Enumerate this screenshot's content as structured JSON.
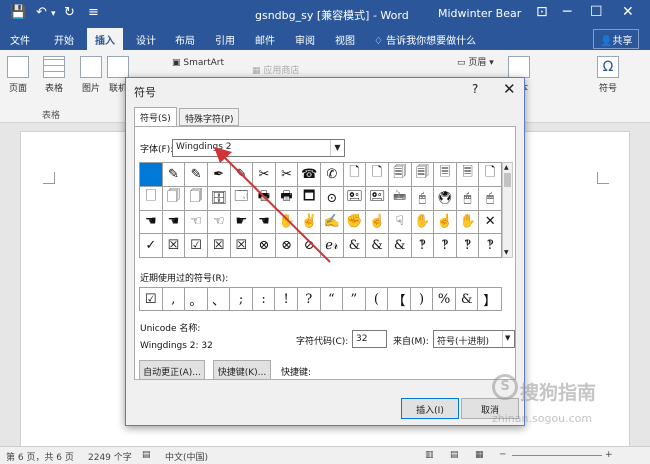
{
  "titlebar": {
    "save_icon": "💾",
    "undo_icon": "↶",
    "undo_dropdown": "▾",
    "redo_icon": "↻",
    "customize_icon": "≡",
    "doc_title": "gsndbg_sy [兼容模式] - Word",
    "user": "Midwinter Bear",
    "ribbon_toggle": "⊡",
    "minimize": "─",
    "maximize": "☐",
    "close": "✕"
  },
  "ribbon_tabs": [
    "文件",
    "开始",
    "插入",
    "设计",
    "布局",
    "引用",
    "邮件",
    "审阅",
    "视图"
  ],
  "tell_me": "告诉我你想要做什么",
  "share": "共享",
  "ribbon": {
    "pages": "页面",
    "table": "表格",
    "picture": "图片",
    "online": "联机",
    "smartart": "SmartArt",
    "app_store": "应用商店",
    "header": "页眉",
    "text": "文本",
    "symbol": "符号",
    "table_group": "表格"
  },
  "status": {
    "page": "第 6 页，共 6 页",
    "words": "2249 个字",
    "lang": "中文(中国)",
    "zoom_minus": "─",
    "zoom_plus": "+"
  },
  "dialog": {
    "title": "符号",
    "help": "?",
    "close": "✕",
    "tab_symbols": "符号(S)",
    "tab_special": "特殊字符(P)",
    "font_label": "字体(F):",
    "font_value": "Wingdings 2",
    "symbols_row1": [
      "",
      "✎",
      "✎",
      "✒",
      "✎",
      "✂",
      "✂",
      "☎",
      "✆",
      "🗋",
      "🗋",
      "🗐",
      "🗐",
      "🗏",
      "🗏",
      "🗋"
    ],
    "symbols_row2": [
      "🗌",
      "🗍",
      "🗍",
      "🗄",
      "🗔",
      "🖶",
      "🖶",
      "🗖",
      "⊙",
      "🖭",
      "🖭",
      "🖮",
      "🖰",
      "🖲",
      "🖱",
      "🖱"
    ],
    "symbols_row3": [
      "☚",
      "☚",
      "☜",
      "☜",
      "☛",
      "☚",
      "✋",
      "✌",
      "✍",
      "✊",
      "☝",
      "☟",
      "✋",
      "☝",
      "✋",
      "✕"
    ],
    "symbols_row4": [
      "✓",
      "☒",
      "☑",
      "☒",
      "☒",
      "⊗",
      "⊗",
      "⊘",
      "ℯ𝓇",
      "&",
      "&",
      "&",
      "‽",
      "‽",
      "‽",
      "‽"
    ],
    "recent_label": "近期使用过的符号(R):",
    "recent": [
      "☑",
      ",",
      "。",
      "、",
      ";",
      ":",
      "!",
      "?",
      "“",
      "”",
      "(",
      "【",
      ")",
      "%",
      "&",
      "】"
    ],
    "unicode_label": "Unicode 名称:",
    "unicode_value": "Wingdings 2: 32",
    "charcode_label": "字符代码(C):",
    "charcode_value": "32",
    "from_label": "来自(M):",
    "from_value": "符号(十进制)",
    "autocorrect": "自动更正(A)...",
    "shortcut_btn": "快捷键(K)...",
    "shortcut_label": "快捷键:",
    "insert": "插入(I)",
    "cancel": "取消"
  },
  "watermark": {
    "logo": "S",
    "name": "搜狗指南",
    "url": "zhinan.sogou.com"
  },
  "colors": {
    "word_blue": "#2b579a",
    "selection": "#0078d7",
    "arrow": "#d13438"
  }
}
